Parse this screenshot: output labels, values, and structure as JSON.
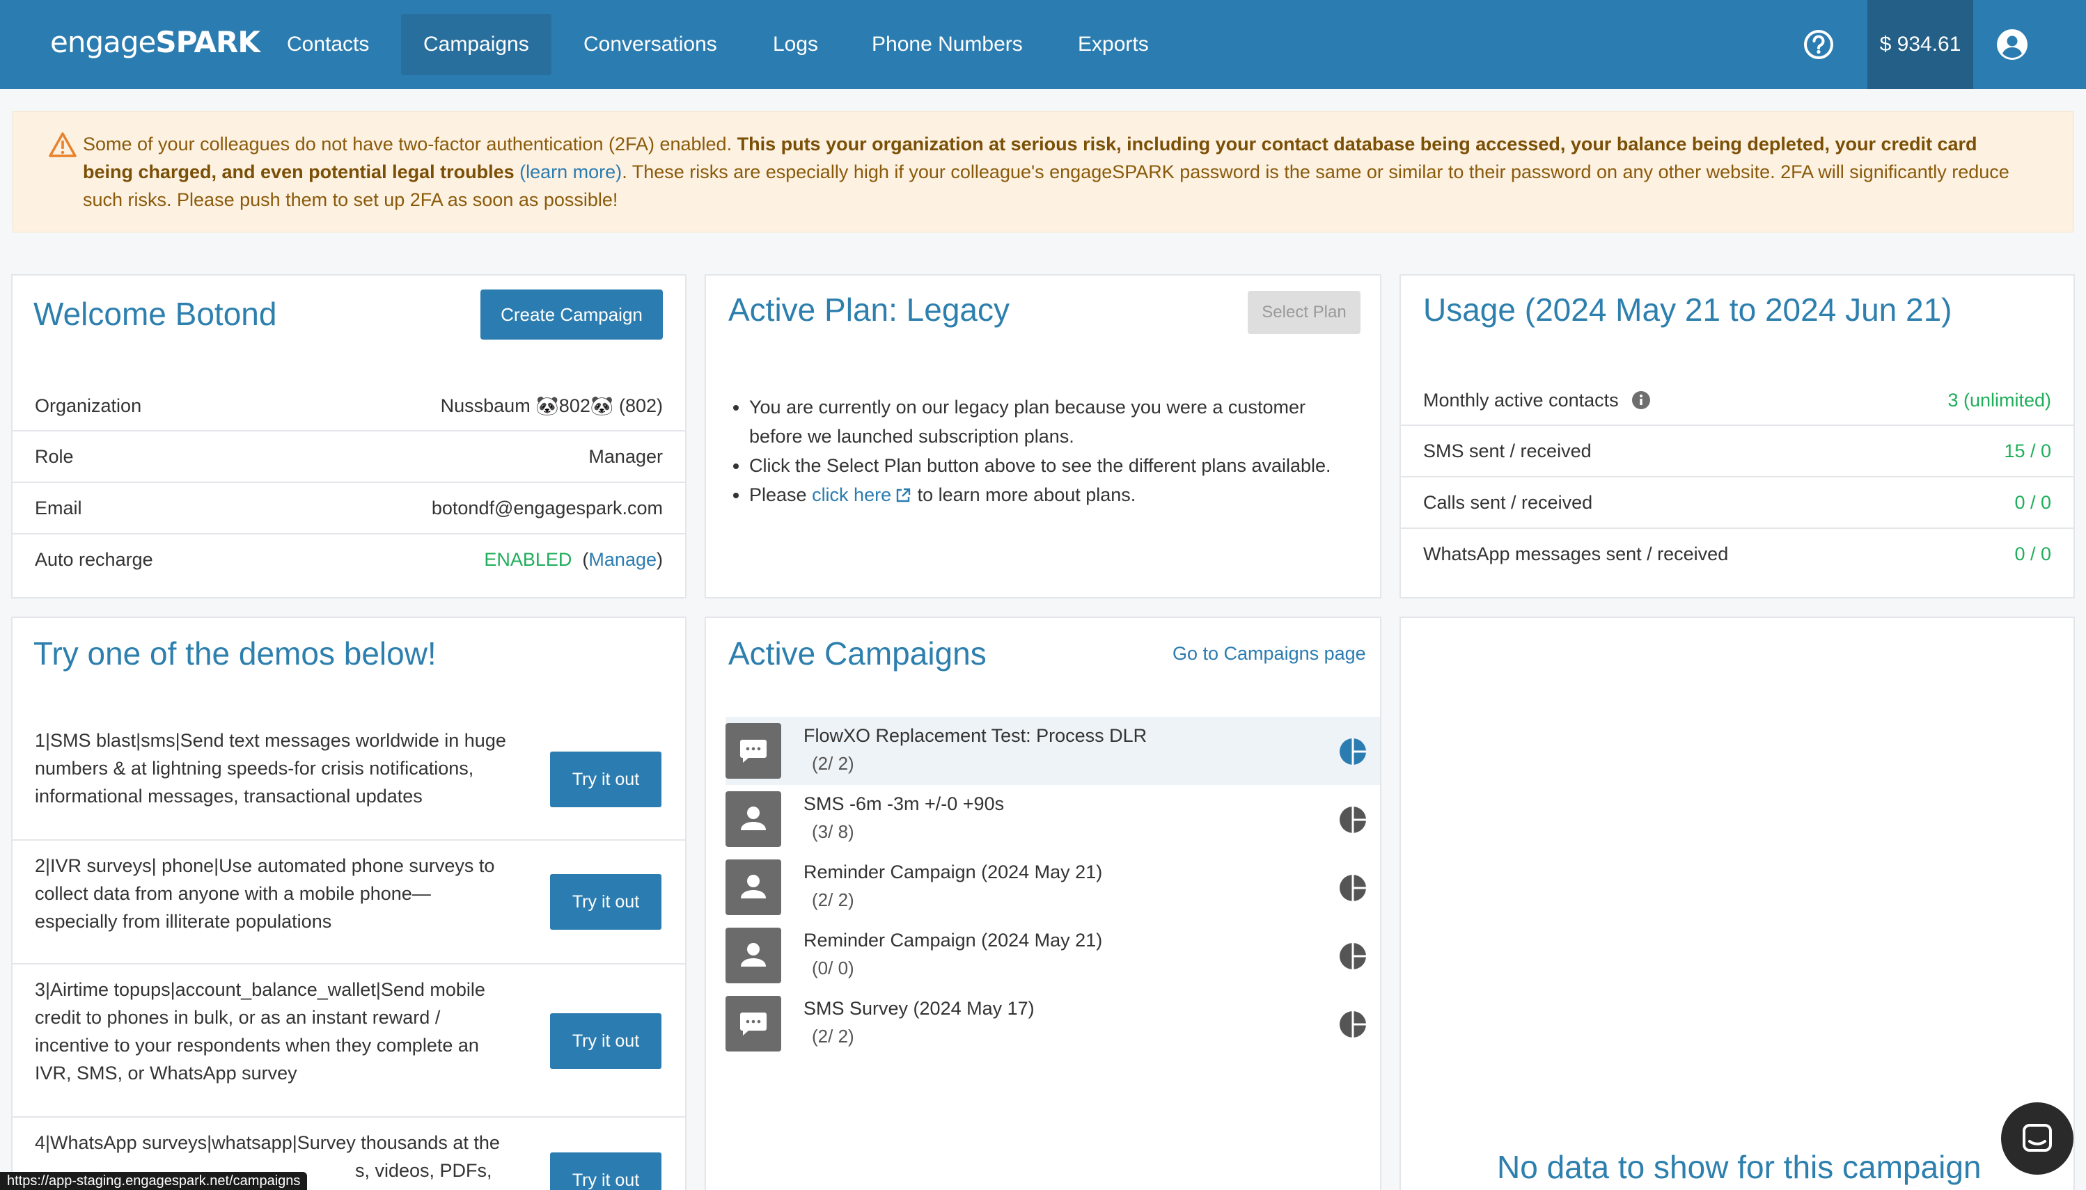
{
  "nav": {
    "brand_light": "engage",
    "brand_bold": "SPARK",
    "links": [
      "Contacts",
      "Campaigns",
      "Conversations",
      "Logs",
      "Phone Numbers",
      "Exports"
    ],
    "active": "Campaigns",
    "balance": "$ 934.61"
  },
  "alert": {
    "text_1": "Some of your colleagues do not have two-factor authentication (2FA) enabled. ",
    "bold": "This puts your organization at serious risk, including your contact database being accessed, your balance being depleted, your credit card being charged, and even potential legal troubles",
    "link": "(learn more)",
    "text_2": ". These risks are especially high if your colleague's engageSPARK password is the same or similar to their password on any other website. 2FA will significantly reduce such risks. Please push them to set up 2FA as soon as possible!"
  },
  "welcome": {
    "title": "Welcome Botond",
    "create_button": "Create Campaign",
    "rows": [
      {
        "label": "Organization",
        "value": "Nussbaum 🐼802🐼 (802)"
      },
      {
        "label": "Role",
        "value": "Manager"
      },
      {
        "label": "Email",
        "value": "botondf@engagespark.com"
      },
      {
        "label": "Auto recharge",
        "value": "ENABLED",
        "manage": "Manage"
      }
    ]
  },
  "plan": {
    "title": "Active Plan: Legacy",
    "select_button": "Select Plan",
    "bullet_1": "You are currently on our legacy plan because you were a customer before we launched subscription plans.",
    "bullet_2": "Click the Select Plan button above to see the different plans available.",
    "bullet_3_pre": "Please ",
    "bullet_3_link": "click here",
    "bullet_3_post": " to learn more about plans."
  },
  "usage": {
    "title": "Usage (2024 May 21 to 2024 Jun 21)",
    "rows": [
      {
        "label": "Monthly active contacts",
        "value": "3 (unlimited)"
      },
      {
        "label": "SMS sent / received",
        "value": "15 / 0"
      },
      {
        "label": "Calls sent / received",
        "value": "0 / 0"
      },
      {
        "label": "WhatsApp messages sent / received",
        "value": "0 / 0"
      }
    ]
  },
  "demos": {
    "title": "Try one of the demos below!",
    "try_label": "Try it out",
    "items": [
      "1|SMS blast|sms|Send text messages worldwide in huge numbers & at lightning speeds-for crisis notifications, informational messages, transactional updates",
      "2|IVR surveys| phone|Use automated phone surveys to collect data from anyone with a mobile phone—especially from illiterate populations",
      "3|Airtime topups|account_balance_wallet|Send mobile credit to phones in bulk, or as an instant reward / incentive to your respondents when they complete an IVR, SMS, or WhatsApp survey",
      "4|WhatsApp surveys|whatsapp|Survey thousands at the",
      "s, videos, PDFs,"
    ]
  },
  "campaigns": {
    "title": "Active Campaigns",
    "link": "Go to Campaigns page",
    "items": [
      {
        "name": "FlowXO Replacement Test: Process DLR",
        "count": "(2/ 2)",
        "icon": "chat-icon",
        "highlight": true
      },
      {
        "name": "SMS -6m -3m +/-0 +90s",
        "count": "(3/ 8)",
        "icon": "person-icon"
      },
      {
        "name": "Reminder Campaign (2024 May 21)",
        "count": "(2/ 2)",
        "icon": "person-icon"
      },
      {
        "name": "Reminder Campaign (2024 May 21)",
        "count": "(0/ 0)",
        "icon": "person-icon"
      },
      {
        "name": "SMS Survey (2024 May 17)",
        "count": "(2/ 2)",
        "icon": "chat-icon"
      }
    ]
  },
  "chart_panel": {
    "empty_text": "No data to show for this campaign"
  },
  "status_url": "https://app-staging.engagespark.net/campaigns"
}
